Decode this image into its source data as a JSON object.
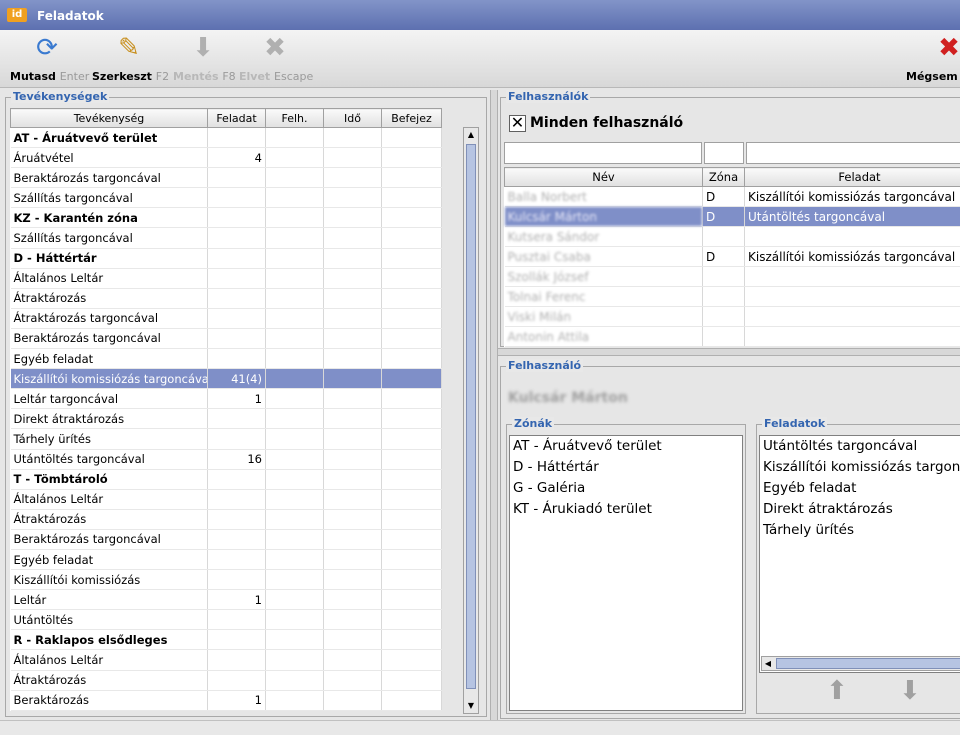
{
  "window": {
    "title": "Feladatok",
    "app_icon": "app-icon"
  },
  "toolbar": {
    "show": {
      "label": "Mutasd",
      "key": "Enter",
      "icon": "refresh-icon"
    },
    "edit": {
      "label": "Szerkeszt",
      "key": "F2",
      "icon": "edit-icon"
    },
    "save": {
      "label": "Mentés",
      "key": "F8",
      "icon": "save-icon"
    },
    "discard": {
      "label": "Elvet",
      "key": "Escape",
      "icon": "discard-icon"
    },
    "cancel": {
      "label": "Mégsem F",
      "icon": "cancel-icon"
    }
  },
  "activities": {
    "group_title": "Tevékenységek",
    "columns": [
      "Tevékenység",
      "Feladat",
      "Felh.",
      "Idő",
      "Befejez"
    ],
    "rows": [
      {
        "name": "AT - Áruátvevő terület",
        "task": "",
        "type": "hdr"
      },
      {
        "name": "Áruátvétel",
        "task": "4"
      },
      {
        "name": "Beraktározás targoncával",
        "task": ""
      },
      {
        "name": "Szállítás targoncával",
        "task": ""
      },
      {
        "name": "KZ - Karantén zóna",
        "task": "",
        "type": "hdr"
      },
      {
        "name": "Szállítás targoncával",
        "task": ""
      },
      {
        "name": "D - Háttértár",
        "task": "",
        "type": "hdr"
      },
      {
        "name": "Általános Leltár",
        "task": ""
      },
      {
        "name": "Átraktározás",
        "task": ""
      },
      {
        "name": "Átraktározás targoncával",
        "task": ""
      },
      {
        "name": "Beraktározás targoncával",
        "task": ""
      },
      {
        "name": "Egyéb feladat",
        "task": ""
      },
      {
        "name": "Kiszállítói komissiózás targoncával",
        "task": "41(4)",
        "type": "sel"
      },
      {
        "name": "Leltár targoncával",
        "task": "1"
      },
      {
        "name": "Direkt átraktározás",
        "task": ""
      },
      {
        "name": "Tárhely ürítés",
        "task": ""
      },
      {
        "name": "Utántöltés targoncával",
        "task": "16"
      },
      {
        "name": "T - Tömbtároló",
        "task": "",
        "type": "hdr"
      },
      {
        "name": "Általános Leltár",
        "task": ""
      },
      {
        "name": "Átraktározás",
        "task": ""
      },
      {
        "name": "Beraktározás targoncával",
        "task": ""
      },
      {
        "name": "Egyéb feladat",
        "task": ""
      },
      {
        "name": "Kiszállítói komissiózás",
        "task": ""
      },
      {
        "name": "Leltár",
        "task": "1"
      },
      {
        "name": "Utántöltés",
        "task": ""
      },
      {
        "name": "R - Raklapos elsődleges",
        "task": "",
        "type": "hdr"
      },
      {
        "name": "Általános Leltár",
        "task": ""
      },
      {
        "name": "Átraktározás",
        "task": ""
      },
      {
        "name": "Beraktározás",
        "task": "1"
      }
    ]
  },
  "users": {
    "group_title": "Felhasználók",
    "all_users_label": "Minden felhasználó",
    "all_users_checked": true,
    "columns": [
      "Név",
      "Zóna",
      "Feladat"
    ],
    "rows": [
      {
        "name": "Balla Norbert",
        "zone": "D",
        "task": "Kiszállítói komissiózás targoncával"
      },
      {
        "name": "Kulcsár Márton",
        "zone": "D",
        "task": "Utántöltés targoncával",
        "sel": true
      },
      {
        "name": "Kutsera Sándor",
        "zone": "",
        "task": ""
      },
      {
        "name": "Pusztai Csaba",
        "zone": "D",
        "task": "Kiszállítói komissiózás targoncával"
      },
      {
        "name": "Szollák József",
        "zone": "",
        "task": ""
      },
      {
        "name": "Tolnai Ferenc",
        "zone": "",
        "task": ""
      },
      {
        "name": "Viski Milán",
        "zone": "",
        "task": ""
      },
      {
        "name": "Antonin Attila",
        "zone": "",
        "task": ""
      }
    ]
  },
  "user_detail": {
    "group_title": "Felhasználó",
    "name": "Kulcsár Márton",
    "zones_title": "Zónák",
    "zones": [
      "AT - Áruátvevő terület",
      "D - Háttértár",
      "G - Galéria",
      "KT - Árukiadó terület"
    ],
    "tasks_title": "Feladatok",
    "tasks": [
      "Utántöltés targoncával",
      "Kiszállítói komissiózás targoncával",
      "Egyéb feladat",
      "Direkt átraktározás",
      "Tárhely ürítés"
    ],
    "up_icon": "arrow-up-icon",
    "down_icon": "arrow-down-icon"
  }
}
